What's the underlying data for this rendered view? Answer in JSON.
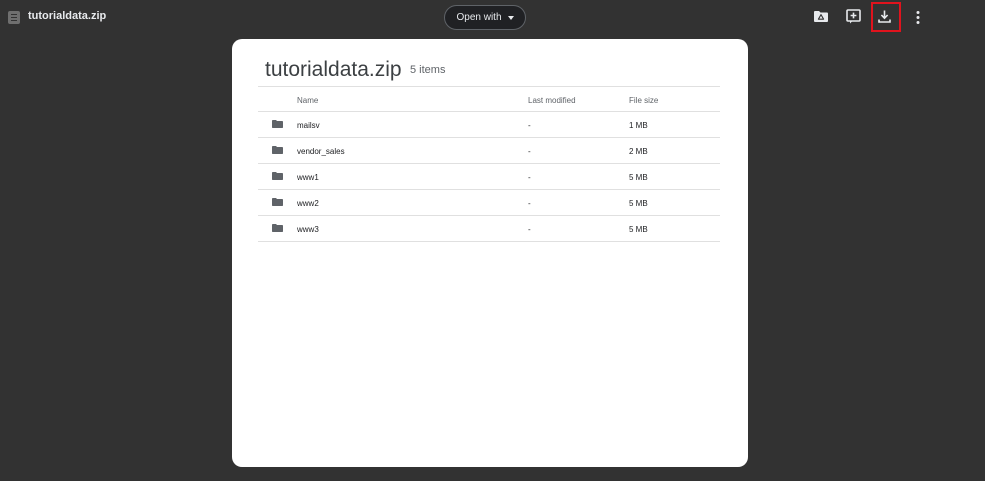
{
  "header": {
    "file_name": "tutorialdata.zip",
    "open_with_label": "Open with",
    "icons": [
      "document-icon",
      "add-to-drive-icon",
      "add-box-icon",
      "download-icon",
      "more-vert-icon"
    ]
  },
  "archive": {
    "title": "tutorialdata.zip",
    "item_count": "5 items",
    "columns": {
      "name": "Name",
      "last_modified": "Last modified",
      "file_size": "File size"
    },
    "rows": [
      {
        "name": "mailsv",
        "last_modified": "-",
        "file_size": "1 MB"
      },
      {
        "name": "vendor_sales",
        "last_modified": "-",
        "file_size": "2 MB"
      },
      {
        "name": "www1",
        "last_modified": "-",
        "file_size": "5 MB"
      },
      {
        "name": "www2",
        "last_modified": "-",
        "file_size": "5 MB"
      },
      {
        "name": "www3",
        "last_modified": "-",
        "file_size": "5 MB"
      }
    ]
  },
  "colors": {
    "background": "#323232",
    "card": "#ffffff",
    "highlight": "#e0131d",
    "folder_icon": "#5f6368"
  }
}
